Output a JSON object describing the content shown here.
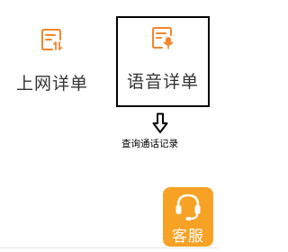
{
  "tiles": {
    "data_detail": {
      "label": "上网详单",
      "icon": "data-list-icon"
    },
    "voice_detail": {
      "label": "语音详单",
      "icon": "voice-list-icon"
    }
  },
  "annotation": {
    "arrow_icon": "down-arrow-icon",
    "note": "查询通话记录"
  },
  "service": {
    "label": "客服",
    "icon": "headset-icon"
  },
  "colors": {
    "accent_orange": "#f5862d",
    "service_bg": "#f7a225",
    "text": "#333333",
    "highlight_border": "#000000"
  }
}
